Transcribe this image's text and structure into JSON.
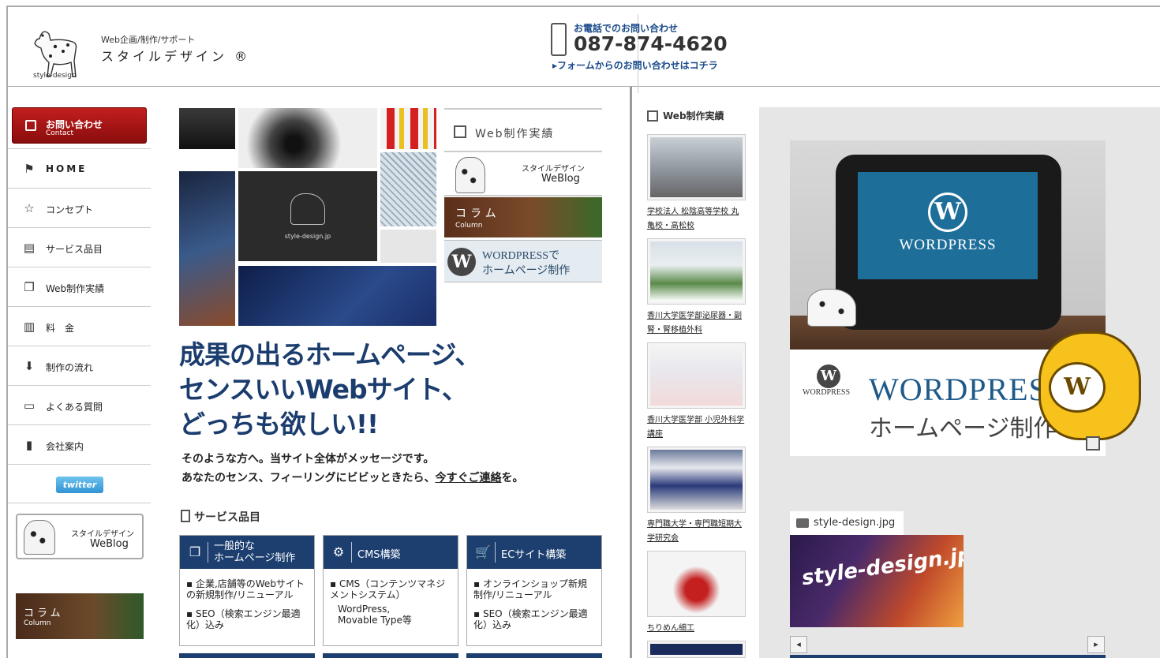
{
  "header": {
    "logo_text": "style-design",
    "tagline": "Web企画/制作/サポート",
    "brand": "スタイルデザイン ®",
    "phone_label": "お電話でのお問い合わせ",
    "phone_number": "087-874-4620",
    "form_link": "▸フォームからのお問い合わせはコチラ"
  },
  "sidebar": {
    "contact": {
      "label": "お問い合わせ",
      "sub": "Contact"
    },
    "items": [
      {
        "label": "HOME",
        "icon": "flag-icon"
      },
      {
        "label": "コンセプト",
        "icon": "star-icon"
      },
      {
        "label": "サービス品目",
        "icon": "document-icon"
      },
      {
        "label": "Web制作実績",
        "icon": "copy-icon"
      },
      {
        "label": "料　金",
        "icon": "grid-icon"
      },
      {
        "label": "制作の流れ",
        "icon": "down-arrow-icon"
      },
      {
        "label": "よくある質問",
        "icon": "speech-bubble-icon"
      },
      {
        "label": "会社案内",
        "icon": "door-icon"
      }
    ],
    "twitter": "twitter",
    "blog": {
      "line1": "スタイルデザイン",
      "line2": "WeBlog"
    },
    "column": {
      "line1": "コラム",
      "line2": "Column"
    }
  },
  "mosaic": {
    "center_text": "style-design.jp"
  },
  "blog_block": {
    "works": "Web制作実績",
    "blog_line1": "スタイルデザイン",
    "blog_line2": "WeBlog",
    "column_line1": "コラム",
    "column_line2": "Column",
    "wp_line1": "WORDPRESSで",
    "wp_line2": "ホームページ制作"
  },
  "main": {
    "headline": [
      "成果の出るホームページ、",
      "センスいいWebサイト、",
      "どっちも欲しい!!"
    ],
    "msg_line1": "そのような方へ。当サイト全体がメッセージです。",
    "msg_line2_pre": "あなたのセンス、フィーリングにビビッときたら、",
    "msg_link": "今すぐご連絡",
    "msg_line2_post": "を。",
    "services_heading": "サービス品目",
    "services": [
      {
        "title": "一般的な\nホームページ制作",
        "icon": "copy-icon",
        "items": [
          "企業,店舗等のWebサイトの新規制作/リニューアル",
          "SEO（検索エンジン最適化）込み"
        ]
      },
      {
        "title": "CMS構築",
        "icon": "gear-icon",
        "items": [
          "CMS（コンテンツマネジメントシステム）",
          "WordPress,\nMovable Type等"
        ]
      },
      {
        "title": "ECサイト構築",
        "icon": "cart-icon",
        "items": [
          "オンラインショップ新規制作/リニューアル",
          "SEO（検索エンジン最適化）込み"
        ]
      }
    ]
  },
  "right": {
    "heading": "Web制作実績",
    "works": [
      {
        "caption": "学校法人 松陰高等学校 丸亀校・高松校"
      },
      {
        "caption": "香川大学医学部泌尿器・副腎・腎移植外科"
      },
      {
        "caption": "香川大学医学部 小児外科学講座"
      },
      {
        "caption": "専門職大学・専門職短期大学研究会"
      },
      {
        "caption": "ちりめん細工"
      }
    ],
    "hero": {
      "screen_logo": "W",
      "screen_name": "WORDPRESS",
      "small_name": "WORDPRESS",
      "big_name": "WORDPRESS",
      "big_sub": "ホームページ制作"
    },
    "file_tab": "style-design.jpg",
    "file_image_text": "style-design.jpg",
    "prev": "◂",
    "next": "▸"
  },
  "colors": {
    "navy": "#1c3f70",
    "red": "#b01818",
    "headline": "#1b3d6e",
    "panel": "#e6e6e6"
  }
}
